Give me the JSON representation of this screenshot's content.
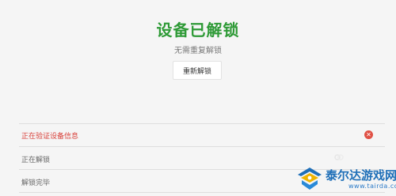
{
  "header": {
    "title": "设备已解锁",
    "subtitle": "无需重复解锁",
    "relock_button": "重新解锁"
  },
  "steps": [
    {
      "label": "正在验证设备信息",
      "status": "error",
      "icon": "error-x-icon"
    },
    {
      "label": "正在解锁",
      "status": "loading",
      "icon": "spinner-icon"
    },
    {
      "label": "解锁完毕",
      "status": "pending"
    }
  ],
  "watermark": {
    "brand": "泰尔达游戏网",
    "url": "www.tairda.com"
  },
  "colors": {
    "success_title": "#2e9a36",
    "error_text": "#d9413a",
    "error_icon": "#e05145",
    "background": "#f5f5f5"
  }
}
